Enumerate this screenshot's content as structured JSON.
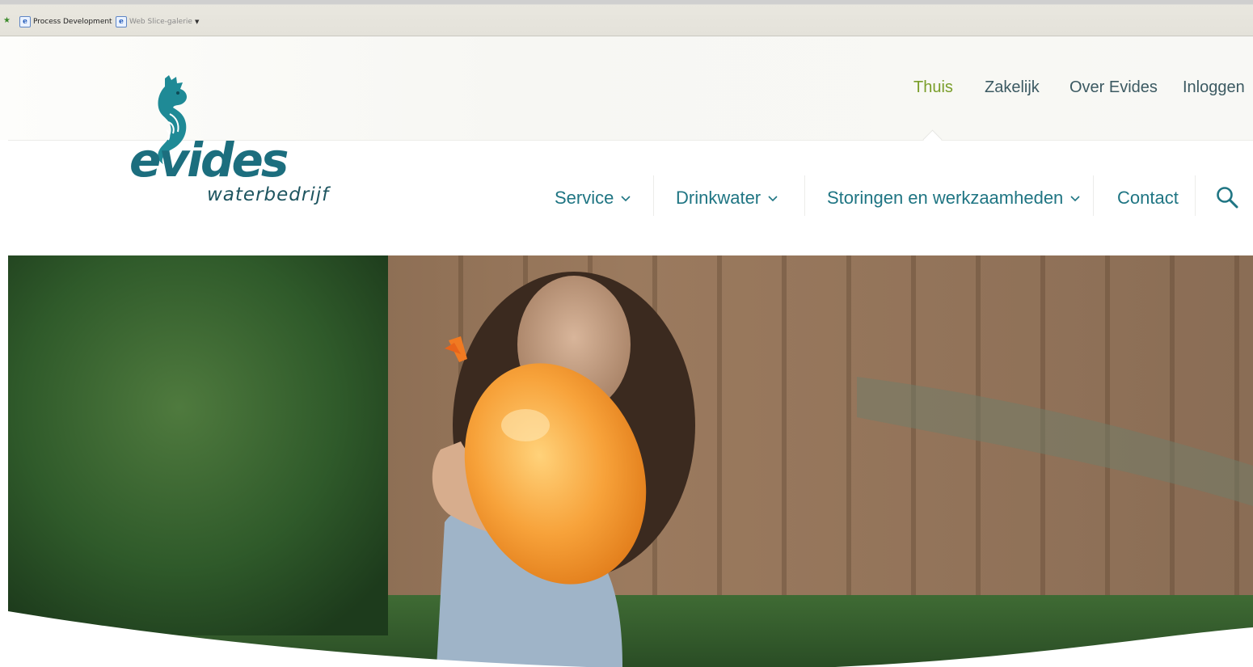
{
  "browser": {
    "favorites": [
      {
        "label": "Process Development"
      },
      {
        "label": "Web Slice-galerie"
      }
    ]
  },
  "header": {
    "logo": {
      "word": "evides",
      "subtitle": "waterbedrijf"
    },
    "top_nav": [
      {
        "label": "Thuis",
        "active": true
      },
      {
        "label": "Zakelijk"
      },
      {
        "label": "Over Evides"
      },
      {
        "label": "Inloggen"
      }
    ],
    "main_nav": [
      {
        "label": "Service"
      },
      {
        "label": "Drinkwater"
      },
      {
        "label": "Storingen en werkzaamheden"
      },
      {
        "label": "Contact"
      }
    ]
  },
  "colors": {
    "brand_teal": "#1f7583",
    "active_green": "#7a9e2a",
    "logo_teal": "#1c6e7e",
    "balloon_orange": "#f2932a"
  },
  "icons": [
    "seahorse-logo-icon",
    "chevron-down-icon",
    "search-icon",
    "ie-page-icon",
    "add-favorite-icon"
  ]
}
